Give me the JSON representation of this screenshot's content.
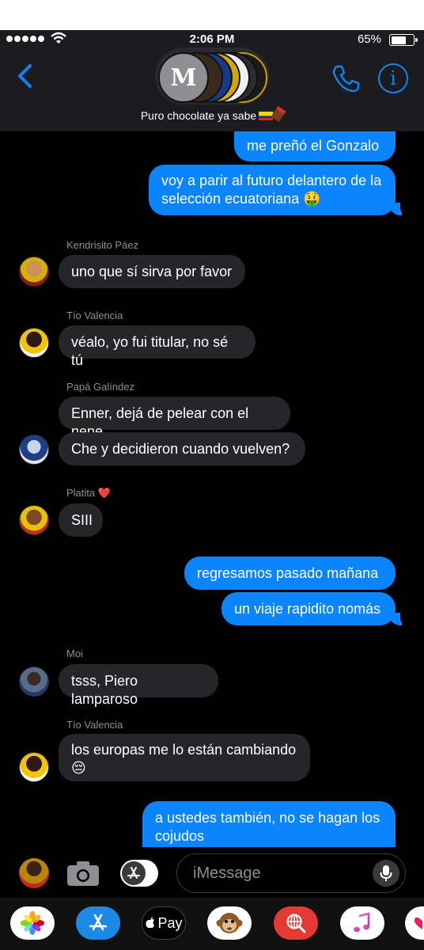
{
  "status": {
    "time": "2:06 PM",
    "battery": "65%"
  },
  "header": {
    "avatar_letter": "M",
    "group_name": "Puro chocolate ya sabe"
  },
  "messages": {
    "m1": "me preñó el Gonzalo",
    "m2_line1": "voy a parir al futuro delantero de la",
    "m2_line2": "selección ecuatoriana 🤑",
    "s1": "Kendrisito Páez",
    "m3": "uno que sí sirva por favor",
    "s2": "Tío Valencia",
    "m4": "véalo, yo fui titular, no sé tú",
    "s3": "Papá Galíndez",
    "m5": "Enner, dejá de pelear con el nene",
    "m6": "Che y decidieron cuando vuelven?",
    "s4": "Platita",
    "s4_heart": "❤️",
    "m7": "SIII",
    "m8": "regresamos pasado mañana",
    "m9": "un viaje rapidito nomás",
    "s5": "Moi",
    "m10": "tsss, Piero lamparoso",
    "s6": "Tío Valencia",
    "m11_line1": "los europas me lo están cambiando",
    "m11_line2": "😔",
    "m12_line1": "a ustedes también, no se hagan los",
    "m12_line2": "cojudos"
  },
  "input": {
    "placeholder": "iMessage"
  },
  "drawer": {
    "applepay_label": "Pay"
  },
  "colors": {
    "accent": "#0a84ff",
    "incoming": "#262628",
    "background": "#000000"
  }
}
